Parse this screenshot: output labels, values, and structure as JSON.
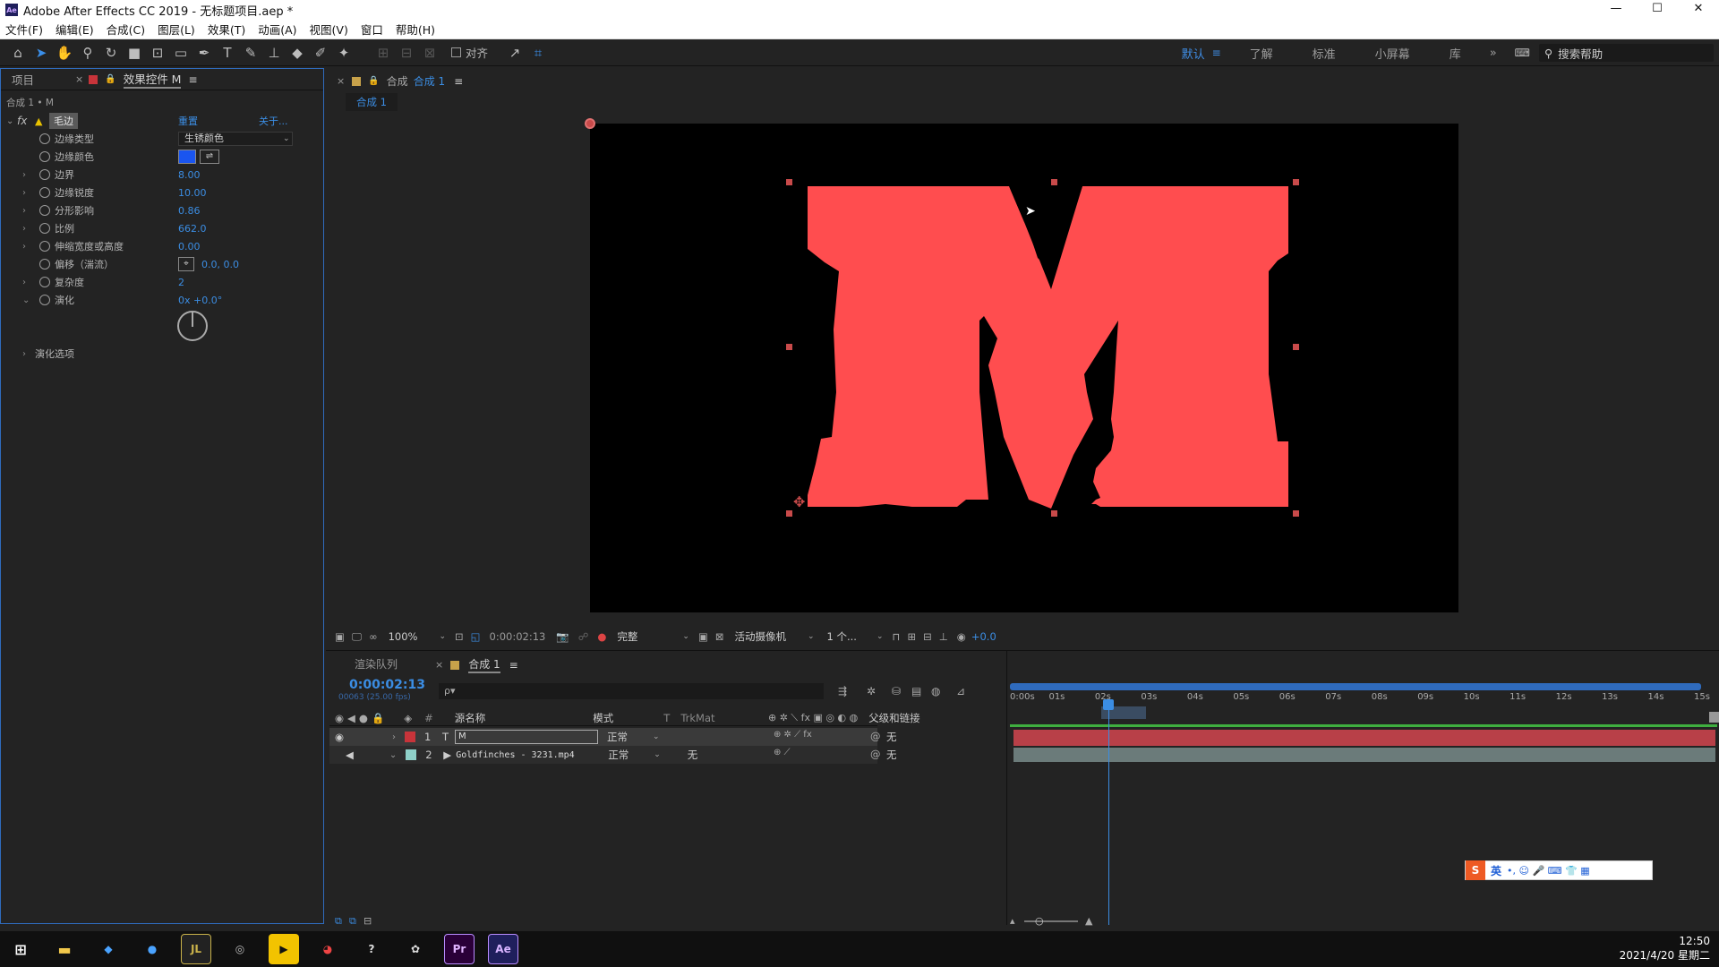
{
  "window": {
    "title": "Adobe After Effects CC 2019 - 无标题项目.aep *",
    "logo": "Ae",
    "minimize": "—",
    "maximize": "☐",
    "close": "✕"
  },
  "menu": [
    "文件(F)",
    "编辑(E)",
    "合成(C)",
    "图层(L)",
    "效果(T)",
    "动画(A)",
    "视图(V)",
    "窗口",
    "帮助(H)"
  ],
  "toolbar": {
    "align_label": "对齐"
  },
  "workspaces": {
    "items": [
      "默认",
      "了解",
      "标准",
      "小屏幕",
      "库"
    ],
    "search_placeholder": "搜索帮助",
    "more": "»"
  },
  "left_panel": {
    "tab_project": "项目",
    "tab_effects": "效果控件 M",
    "breadcrumb": "合成 1 • M",
    "effect_name": "毛边",
    "reset": "重置",
    "about": "关于...",
    "props": [
      {
        "label": "边缘类型",
        "value": "生锈颜色"
      },
      {
        "label": "边缘颜色",
        "value": ""
      },
      {
        "label": "边界",
        "value": "8.00"
      },
      {
        "label": "边缘锐度",
        "value": "10.00"
      },
      {
        "label": "分形影响",
        "value": "0.86"
      },
      {
        "label": "比例",
        "value": "662.0"
      },
      {
        "label": "伸缩宽度或高度",
        "value": "0.00"
      },
      {
        "label": "偏移（湍流）",
        "value": "0.0, 0.0"
      },
      {
        "label": "复杂度",
        "value": "2"
      },
      {
        "label": "演化",
        "value": "0x +0.0°"
      }
    ],
    "evolution_options": "演化选项",
    "edge_color": "#1a55f0"
  },
  "comp_panel": {
    "tab_label": "合成",
    "comp_name": "合成 1",
    "sub_tab": "合成 1",
    "letter": "M",
    "letter_color": "#ff4d4f",
    "viewer_bar": {
      "zoom": "100%",
      "timecode": "0:00:02:13",
      "quality": "完整",
      "camera": "活动摄像机",
      "views": "1 个...",
      "exposure": "+0.0"
    }
  },
  "timeline": {
    "tab_render": "渲染队列",
    "tab_comp": "合成 1",
    "timecode": "0:00:02:13",
    "frame_info": "00063 (25.00 fps)",
    "search_placeholder": "ρ▾",
    "columns": {
      "source": "源名称",
      "mode": "模式",
      "t": "T",
      "trkmat": "TrkMat",
      "parent": "父级和链接"
    },
    "ruler": [
      "0:00s",
      "01s",
      "02s",
      "03s",
      "04s",
      "05s",
      "06s",
      "07s",
      "08s",
      "09s",
      "10s",
      "11s",
      "12s",
      "13s",
      "14s",
      "15s"
    ],
    "layers": [
      {
        "num": "1",
        "type": "T",
        "name": "M",
        "mode": "正常",
        "trkmat": "",
        "parent": "无",
        "color": "#c8343a"
      },
      {
        "num": "2",
        "type": "▶",
        "name": "Goldfinches - 3231.mp4",
        "mode": "正常",
        "trkmat": "无",
        "parent": "无",
        "color": "#8ed0c8"
      }
    ]
  },
  "ime": {
    "label": "英",
    "extra": "•, ☺ 🎤 ⌨ 👕 ▦"
  },
  "taskbar": {
    "time": "12:50",
    "date": "2021/4/20 星期二",
    "apps": [
      "JL",
      "Pr",
      "Ae"
    ]
  }
}
